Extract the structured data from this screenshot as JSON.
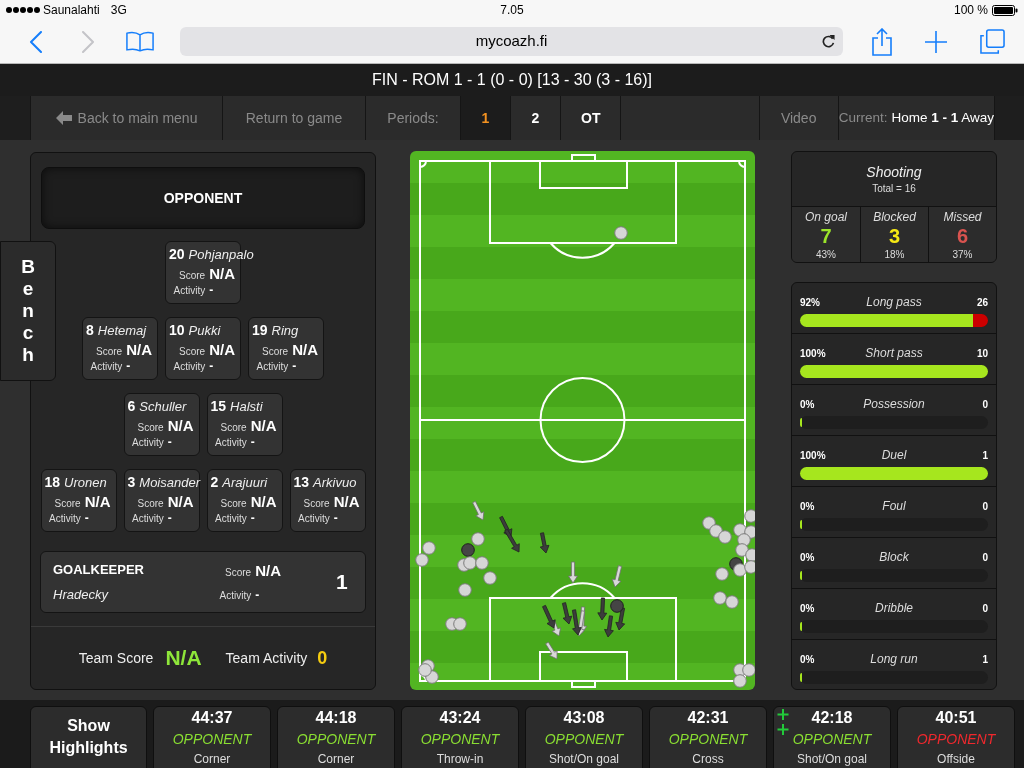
{
  "status_bar": {
    "carrier": "Saunalahti",
    "network": "3G",
    "time": "7.05",
    "battery": "100 %"
  },
  "browser": {
    "history": [
      {
        "kind": "back",
        "disabled": false
      },
      {
        "kind": "forward",
        "disabled": true
      }
    ],
    "url": "mycoazh.fi"
  },
  "match_header": {
    "title": "FIN - ROM 1 - 1 (0 - 0) [13 - 30 (3 - 16)]"
  },
  "nav": {
    "back": "Back to main menu",
    "return": "Return to game",
    "periods_label": "Periods:",
    "periods": [
      {
        "label": "1",
        "selected": true
      },
      {
        "label": "2",
        "selected": false
      },
      {
        "label": "OT",
        "selected": false
      }
    ],
    "video": "Video",
    "current_label": "Current:",
    "current_value": "Home **1 - 1** Away"
  },
  "lineup": {
    "team": "OPPONENT",
    "bench": "Bench",
    "lines": [
      {
        "players": [
          {
            "number": "20",
            "name": "Pohjanpalo",
            "score_label": "Score",
            "score": "N/A",
            "activity_label": "Activity",
            "activity": "-"
          }
        ]
      },
      {
        "players": [
          {
            "number": "8",
            "name": "Hetemaj",
            "score_label": "Score",
            "score": "N/A",
            "activity_label": "Activity",
            "activity": "-"
          },
          {
            "number": "10",
            "name": "Pukki",
            "score_label": "Score",
            "score": "N/A",
            "activity_label": "Activity",
            "activity": "-"
          },
          {
            "number": "19",
            "name": "Ring",
            "score_label": "Score",
            "score": "N/A",
            "activity_label": "Activity",
            "activity": "-"
          }
        ]
      },
      {
        "players": [
          {
            "number": "6",
            "name": "Schuller",
            "score_label": "Score",
            "score": "N/A",
            "activity_label": "Activity",
            "activity": "-"
          },
          {
            "number": "15",
            "name": "Halsti",
            "score_label": "Score",
            "score": "N/A",
            "activity_label": "Activity",
            "activity": "-"
          }
        ]
      },
      {
        "players": [
          {
            "number": "18",
            "name": "Uronen",
            "score_label": "Score",
            "score": "N/A",
            "activity_label": "Activity",
            "activity": "-"
          },
          {
            "number": "3",
            "name": "Moisander",
            "score_label": "Score",
            "score": "N/A",
            "activity_label": "Activity",
            "activity": "-"
          },
          {
            "number": "2",
            "name": "Arajuuri",
            "score_label": "Score",
            "score": "N/A",
            "activity_label": "Activity",
            "activity": "-"
          },
          {
            "number": "13",
            "name": "Arkivuo",
            "score_label": "Score",
            "score": "N/A",
            "activity_label": "Activity",
            "activity": "-"
          }
        ]
      }
    ],
    "goalkeeper": {
      "title": "GOALKEEPER",
      "name": "Hradecky",
      "score_label": "Score",
      "score": "N/A",
      "activity_label": "Activity",
      "activity": "-",
      "number": "1"
    },
    "team_score_label": "Team Score",
    "team_score": "N/A",
    "team_activity_label": "Team Activity",
    "team_activity": "0"
  },
  "shooting": {
    "title": "Shooting",
    "total": "Total = 16",
    "cells": [
      {
        "label": "On goal",
        "value": "7",
        "percent": "43%",
        "color": "#9be42a"
      },
      {
        "label": "Blocked",
        "value": "3",
        "percent": "18%",
        "color": "#f5e814"
      },
      {
        "label": "Missed",
        "value": "6",
        "percent": "37%",
        "color": "#d9534f"
      }
    ]
  },
  "stats": [
    {
      "percent": "92%",
      "label": "Long pass",
      "count": "26",
      "level": 0.92
    },
    {
      "percent": "100%",
      "label": "Short pass",
      "count": "10",
      "level": 1
    },
    {
      "percent": "0%",
      "label": "Possession",
      "count": "0",
      "level": 0
    },
    {
      "percent": "100%",
      "label": "Duel",
      "count": "1",
      "level": 1
    },
    {
      "percent": "0%",
      "label": "Foul",
      "count": "0",
      "level": 0
    },
    {
      "percent": "0%",
      "label": "Block",
      "count": "0",
      "level": 0
    },
    {
      "percent": "0%",
      "label": "Dribble",
      "count": "0",
      "level": 0
    },
    {
      "percent": "0%",
      "label": "Long run",
      "count": "1",
      "level": 0
    }
  ],
  "bottom_bar": {
    "highlights": "Show Highlights",
    "events": [
      {
        "time": "44:37",
        "team": "OPPONENT",
        "color": "#8ade32",
        "event": "Corner",
        "flagged": false
      },
      {
        "time": "44:18",
        "team": "OPPONENT",
        "color": "#8ade32",
        "event": "Corner",
        "flagged": false
      },
      {
        "time": "43:24",
        "team": "OPPONENT",
        "color": "#8ade32",
        "event": "Throw-in",
        "flagged": false
      },
      {
        "time": "43:08",
        "team": "OPPONENT",
        "color": "#8ade32",
        "event": "Shot/On goal",
        "flagged": false
      },
      {
        "time": "42:31",
        "team": "OPPONENT",
        "color": "#8ade32",
        "event": "Cross",
        "flagged": false
      },
      {
        "time": "42:18",
        "team": "OPPONENT",
        "color": "#8ade32",
        "event": "Shot/On goal",
        "flagged": true
      },
      {
        "time": "40:51",
        "team": "OPPONENT",
        "color": "#f0282d",
        "event": "Offside",
        "flagged": false
      }
    ]
  }
}
